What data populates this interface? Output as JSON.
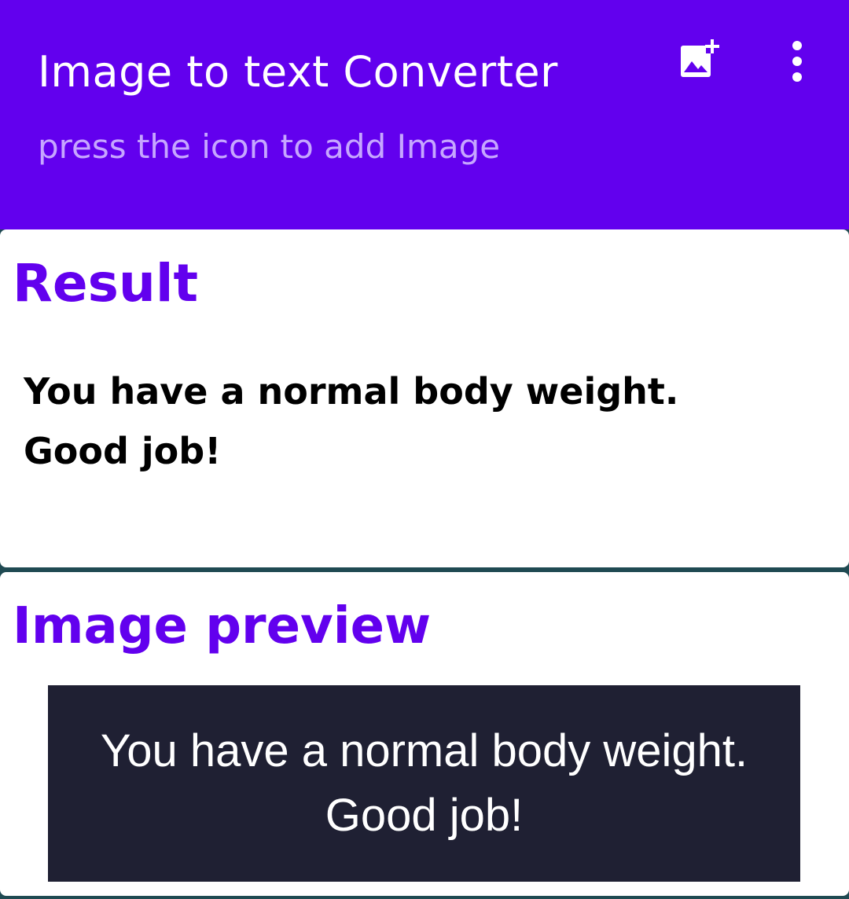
{
  "app_bar": {
    "title": "Image to text Converter",
    "subtitle": "press the icon to add Image",
    "background": "#6200ee",
    "actions": [
      {
        "icon": "add-photo-icon"
      },
      {
        "icon": "more-vert-icon"
      }
    ]
  },
  "result_card": {
    "title": "Result",
    "text": "You have a normal body weight.\nGood job!"
  },
  "preview_card": {
    "title": "Image preview",
    "image_text": "You have a normal body weight.\nGood job!"
  },
  "colors": {
    "accent": "#6200ee",
    "subtitle": "#c6a6ff",
    "preview_bg": "#1f2033"
  }
}
